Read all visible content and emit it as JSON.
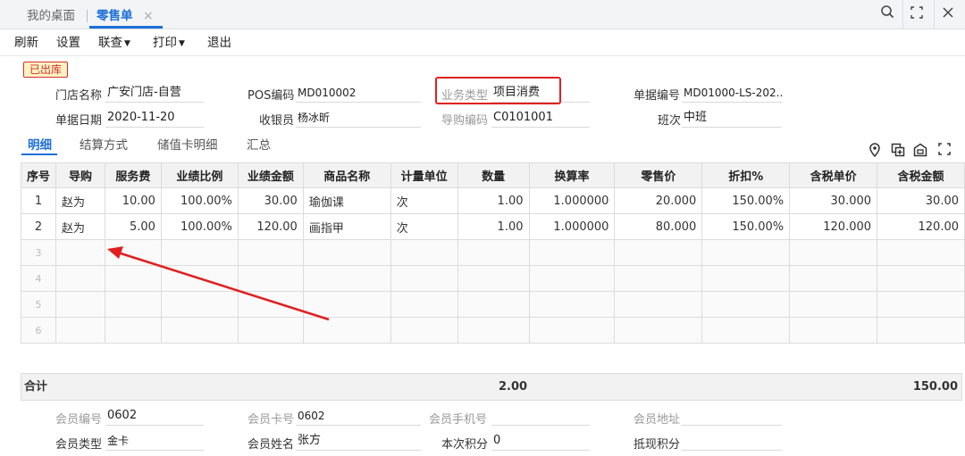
{
  "tabs": {
    "home": "我的桌面",
    "active": "零售单",
    "close": "×"
  },
  "window_controls": {
    "search": "search-icon",
    "fullscreen": "fullscreen-icon",
    "close": "close-icon"
  },
  "toolbar": {
    "refresh": "刷新",
    "settings": "设置",
    "link": "联查",
    "print": "打印",
    "exit": "退出"
  },
  "status_badge": "已出库",
  "header": {
    "store_label": "门店名称",
    "store_value": "广安门店-自营",
    "pos_label": "POS编码",
    "pos_value": "MD010002",
    "biz_type_label": "业务类型",
    "biz_type_value": "项目消费",
    "doc_no_label": "单据编号",
    "doc_no_value": "MD01000-LS-202...",
    "date_label": "单据日期",
    "date_value": "2020-11-20",
    "cashier_label": "收银员",
    "cashier_value": "杨冰昕",
    "guide_code_label": "导购编码",
    "guide_code_value": "C0101001",
    "shift_label": "班次",
    "shift_value": "中班"
  },
  "subtabs": [
    "明细",
    "结算方式",
    "储值卡明细",
    "汇总"
  ],
  "grid": {
    "columns": [
      "序号",
      "导购",
      "服务费",
      "业绩比例",
      "业绩金额",
      "商品名称",
      "计量单位",
      "数量",
      "换算率",
      "零售价",
      "折扣%",
      "含税单价",
      "含税金额"
    ],
    "rows": [
      [
        "1",
        "赵为",
        "10.00",
        "100.00%",
        "30.00",
        "瑜伽课",
        "次",
        "1.00",
        "1.000000",
        "20.000",
        "150.00%",
        "30.000",
        "30.00"
      ],
      [
        "2",
        "赵为",
        "5.00",
        "100.00%",
        "120.00",
        "画指甲",
        "次",
        "1.00",
        "1.000000",
        "80.000",
        "150.00%",
        "120.000",
        "120.00"
      ]
    ],
    "empty_rows": [
      "3",
      "4",
      "5",
      "6"
    ]
  },
  "totals": {
    "label": "合计",
    "quantity": "2.00",
    "amount": "150.00"
  },
  "footer": {
    "member_no_label": "会员编号",
    "member_no_value": "0602",
    "card_no_label": "会员卡号",
    "card_no_value": "0602",
    "phone_label": "会员手机号",
    "phone_value": "",
    "address_label": "会员地址",
    "address_value": "",
    "member_type_label": "会员类型",
    "member_type_value": "金卡",
    "member_name_label": "会员姓名",
    "member_name_value": "张方",
    "points_label": "本次积分",
    "points_value": "0",
    "redeem_label": "抵现积分",
    "redeem_value": ""
  },
  "colors": {
    "accent": "#1e6fd9",
    "highlight": "#e02020",
    "badge_bg": "#fff3c4"
  }
}
